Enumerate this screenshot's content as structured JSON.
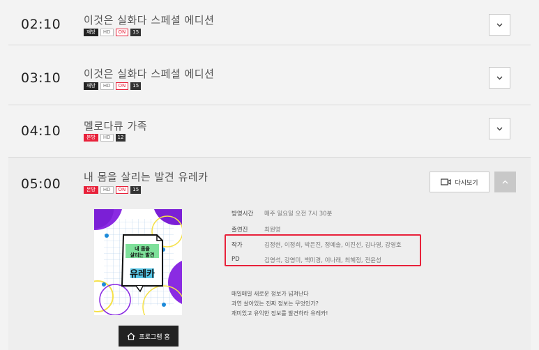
{
  "schedule": [
    {
      "time": "02:10",
      "title": "이것은 실화다 스페셜 에디션",
      "badges": [
        {
          "text": "재방",
          "style": "dark"
        },
        {
          "text": "HD",
          "style": "plain"
        },
        {
          "text": "ON",
          "style": "on"
        },
        {
          "text": "15",
          "style": "age"
        }
      ]
    },
    {
      "time": "03:10",
      "title": "이것은 실화다 스페셜 에디션",
      "badges": [
        {
          "text": "재방",
          "style": "dark"
        },
        {
          "text": "HD",
          "style": "plain"
        },
        {
          "text": "ON",
          "style": "on"
        },
        {
          "text": "15",
          "style": "age"
        }
      ]
    },
    {
      "time": "04:10",
      "title": "멜로다큐 가족",
      "badges": [
        {
          "text": "본방",
          "style": "red"
        },
        {
          "text": "HD",
          "style": "plain"
        },
        {
          "text": "12",
          "style": "age"
        }
      ]
    },
    {
      "time": "05:00",
      "title": "내 몸을 살리는 발견 유레카",
      "badges": [
        {
          "text": "본방",
          "style": "red"
        },
        {
          "text": "HD",
          "style": "plain"
        },
        {
          "text": "ON",
          "style": "on"
        },
        {
          "text": "15",
          "style": "age"
        }
      ]
    }
  ],
  "expanded": {
    "replay_label": "다시보기",
    "program_button_label": "프로그램 홈",
    "thumbnail_text": {
      "line1": "내 몸을",
      "line2": "살리는 발견",
      "line3": "유레카"
    },
    "info": [
      {
        "label": "방영시간",
        "value": "매주 일요일 오전 7시 30분"
      },
      {
        "label": "출연진",
        "value": "최원영"
      },
      {
        "label": "작가",
        "value": "김정현, 이정희, 박은진, 정예솔, 이진선, 김나영, 강영호"
      },
      {
        "label": "PD",
        "value": "김영석, 강영미, 백미경, 이나래, 최혜정, 전윤성"
      }
    ],
    "description": [
      "매일매일 새로운 정보가 넘쳐난다",
      "과연 살아있는 진짜 정보는 무엇인가?",
      "재미있고 유익한 정보를 발견하라 유레카!"
    ]
  },
  "colors": {
    "accent_red": "#e8213a",
    "background": "#f3f3f3"
  },
  "icons": {
    "expand": "chevron-down-icon",
    "collapse": "chevron-up-icon",
    "replay": "video-camera-icon",
    "home": "home-icon"
  }
}
